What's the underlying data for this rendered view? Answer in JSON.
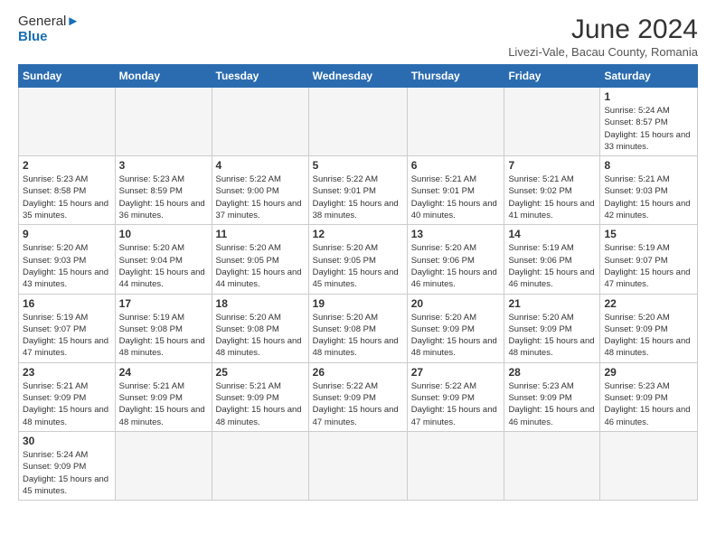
{
  "header": {
    "logo_general": "General",
    "logo_blue": "Blue",
    "month_year": "June 2024",
    "location": "Livezi-Vale, Bacau County, Romania"
  },
  "days_of_week": [
    "Sunday",
    "Monday",
    "Tuesday",
    "Wednesday",
    "Thursday",
    "Friday",
    "Saturday"
  ],
  "weeks": [
    [
      {
        "day": "",
        "info": ""
      },
      {
        "day": "",
        "info": ""
      },
      {
        "day": "",
        "info": ""
      },
      {
        "day": "",
        "info": ""
      },
      {
        "day": "",
        "info": ""
      },
      {
        "day": "",
        "info": ""
      },
      {
        "day": "1",
        "info": "Sunrise: 5:24 AM\nSunset: 8:57 PM\nDaylight: 15 hours and 33 minutes."
      }
    ],
    [
      {
        "day": "2",
        "info": "Sunrise: 5:23 AM\nSunset: 8:58 PM\nDaylight: 15 hours and 35 minutes."
      },
      {
        "day": "3",
        "info": "Sunrise: 5:23 AM\nSunset: 8:59 PM\nDaylight: 15 hours and 36 minutes."
      },
      {
        "day": "4",
        "info": "Sunrise: 5:22 AM\nSunset: 9:00 PM\nDaylight: 15 hours and 37 minutes."
      },
      {
        "day": "5",
        "info": "Sunrise: 5:22 AM\nSunset: 9:01 PM\nDaylight: 15 hours and 38 minutes."
      },
      {
        "day": "6",
        "info": "Sunrise: 5:21 AM\nSunset: 9:01 PM\nDaylight: 15 hours and 40 minutes."
      },
      {
        "day": "7",
        "info": "Sunrise: 5:21 AM\nSunset: 9:02 PM\nDaylight: 15 hours and 41 minutes."
      },
      {
        "day": "8",
        "info": "Sunrise: 5:21 AM\nSunset: 9:03 PM\nDaylight: 15 hours and 42 minutes."
      }
    ],
    [
      {
        "day": "9",
        "info": "Sunrise: 5:20 AM\nSunset: 9:03 PM\nDaylight: 15 hours and 43 minutes."
      },
      {
        "day": "10",
        "info": "Sunrise: 5:20 AM\nSunset: 9:04 PM\nDaylight: 15 hours and 44 minutes."
      },
      {
        "day": "11",
        "info": "Sunrise: 5:20 AM\nSunset: 9:05 PM\nDaylight: 15 hours and 44 minutes."
      },
      {
        "day": "12",
        "info": "Sunrise: 5:20 AM\nSunset: 9:05 PM\nDaylight: 15 hours and 45 minutes."
      },
      {
        "day": "13",
        "info": "Sunrise: 5:20 AM\nSunset: 9:06 PM\nDaylight: 15 hours and 46 minutes."
      },
      {
        "day": "14",
        "info": "Sunrise: 5:19 AM\nSunset: 9:06 PM\nDaylight: 15 hours and 46 minutes."
      },
      {
        "day": "15",
        "info": "Sunrise: 5:19 AM\nSunset: 9:07 PM\nDaylight: 15 hours and 47 minutes."
      }
    ],
    [
      {
        "day": "16",
        "info": "Sunrise: 5:19 AM\nSunset: 9:07 PM\nDaylight: 15 hours and 47 minutes."
      },
      {
        "day": "17",
        "info": "Sunrise: 5:19 AM\nSunset: 9:08 PM\nDaylight: 15 hours and 48 minutes."
      },
      {
        "day": "18",
        "info": "Sunrise: 5:20 AM\nSunset: 9:08 PM\nDaylight: 15 hours and 48 minutes."
      },
      {
        "day": "19",
        "info": "Sunrise: 5:20 AM\nSunset: 9:08 PM\nDaylight: 15 hours and 48 minutes."
      },
      {
        "day": "20",
        "info": "Sunrise: 5:20 AM\nSunset: 9:09 PM\nDaylight: 15 hours and 48 minutes."
      },
      {
        "day": "21",
        "info": "Sunrise: 5:20 AM\nSunset: 9:09 PM\nDaylight: 15 hours and 48 minutes."
      },
      {
        "day": "22",
        "info": "Sunrise: 5:20 AM\nSunset: 9:09 PM\nDaylight: 15 hours and 48 minutes."
      }
    ],
    [
      {
        "day": "23",
        "info": "Sunrise: 5:21 AM\nSunset: 9:09 PM\nDaylight: 15 hours and 48 minutes."
      },
      {
        "day": "24",
        "info": "Sunrise: 5:21 AM\nSunset: 9:09 PM\nDaylight: 15 hours and 48 minutes."
      },
      {
        "day": "25",
        "info": "Sunrise: 5:21 AM\nSunset: 9:09 PM\nDaylight: 15 hours and 48 minutes."
      },
      {
        "day": "26",
        "info": "Sunrise: 5:22 AM\nSunset: 9:09 PM\nDaylight: 15 hours and 47 minutes."
      },
      {
        "day": "27",
        "info": "Sunrise: 5:22 AM\nSunset: 9:09 PM\nDaylight: 15 hours and 47 minutes."
      },
      {
        "day": "28",
        "info": "Sunrise: 5:23 AM\nSunset: 9:09 PM\nDaylight: 15 hours and 46 minutes."
      },
      {
        "day": "29",
        "info": "Sunrise: 5:23 AM\nSunset: 9:09 PM\nDaylight: 15 hours and 46 minutes."
      }
    ],
    [
      {
        "day": "30",
        "info": "Sunrise: 5:24 AM\nSunset: 9:09 PM\nDaylight: 15 hours and 45 minutes."
      },
      {
        "day": "",
        "info": ""
      },
      {
        "day": "",
        "info": ""
      },
      {
        "day": "",
        "info": ""
      },
      {
        "day": "",
        "info": ""
      },
      {
        "day": "",
        "info": ""
      },
      {
        "day": "",
        "info": ""
      }
    ]
  ]
}
